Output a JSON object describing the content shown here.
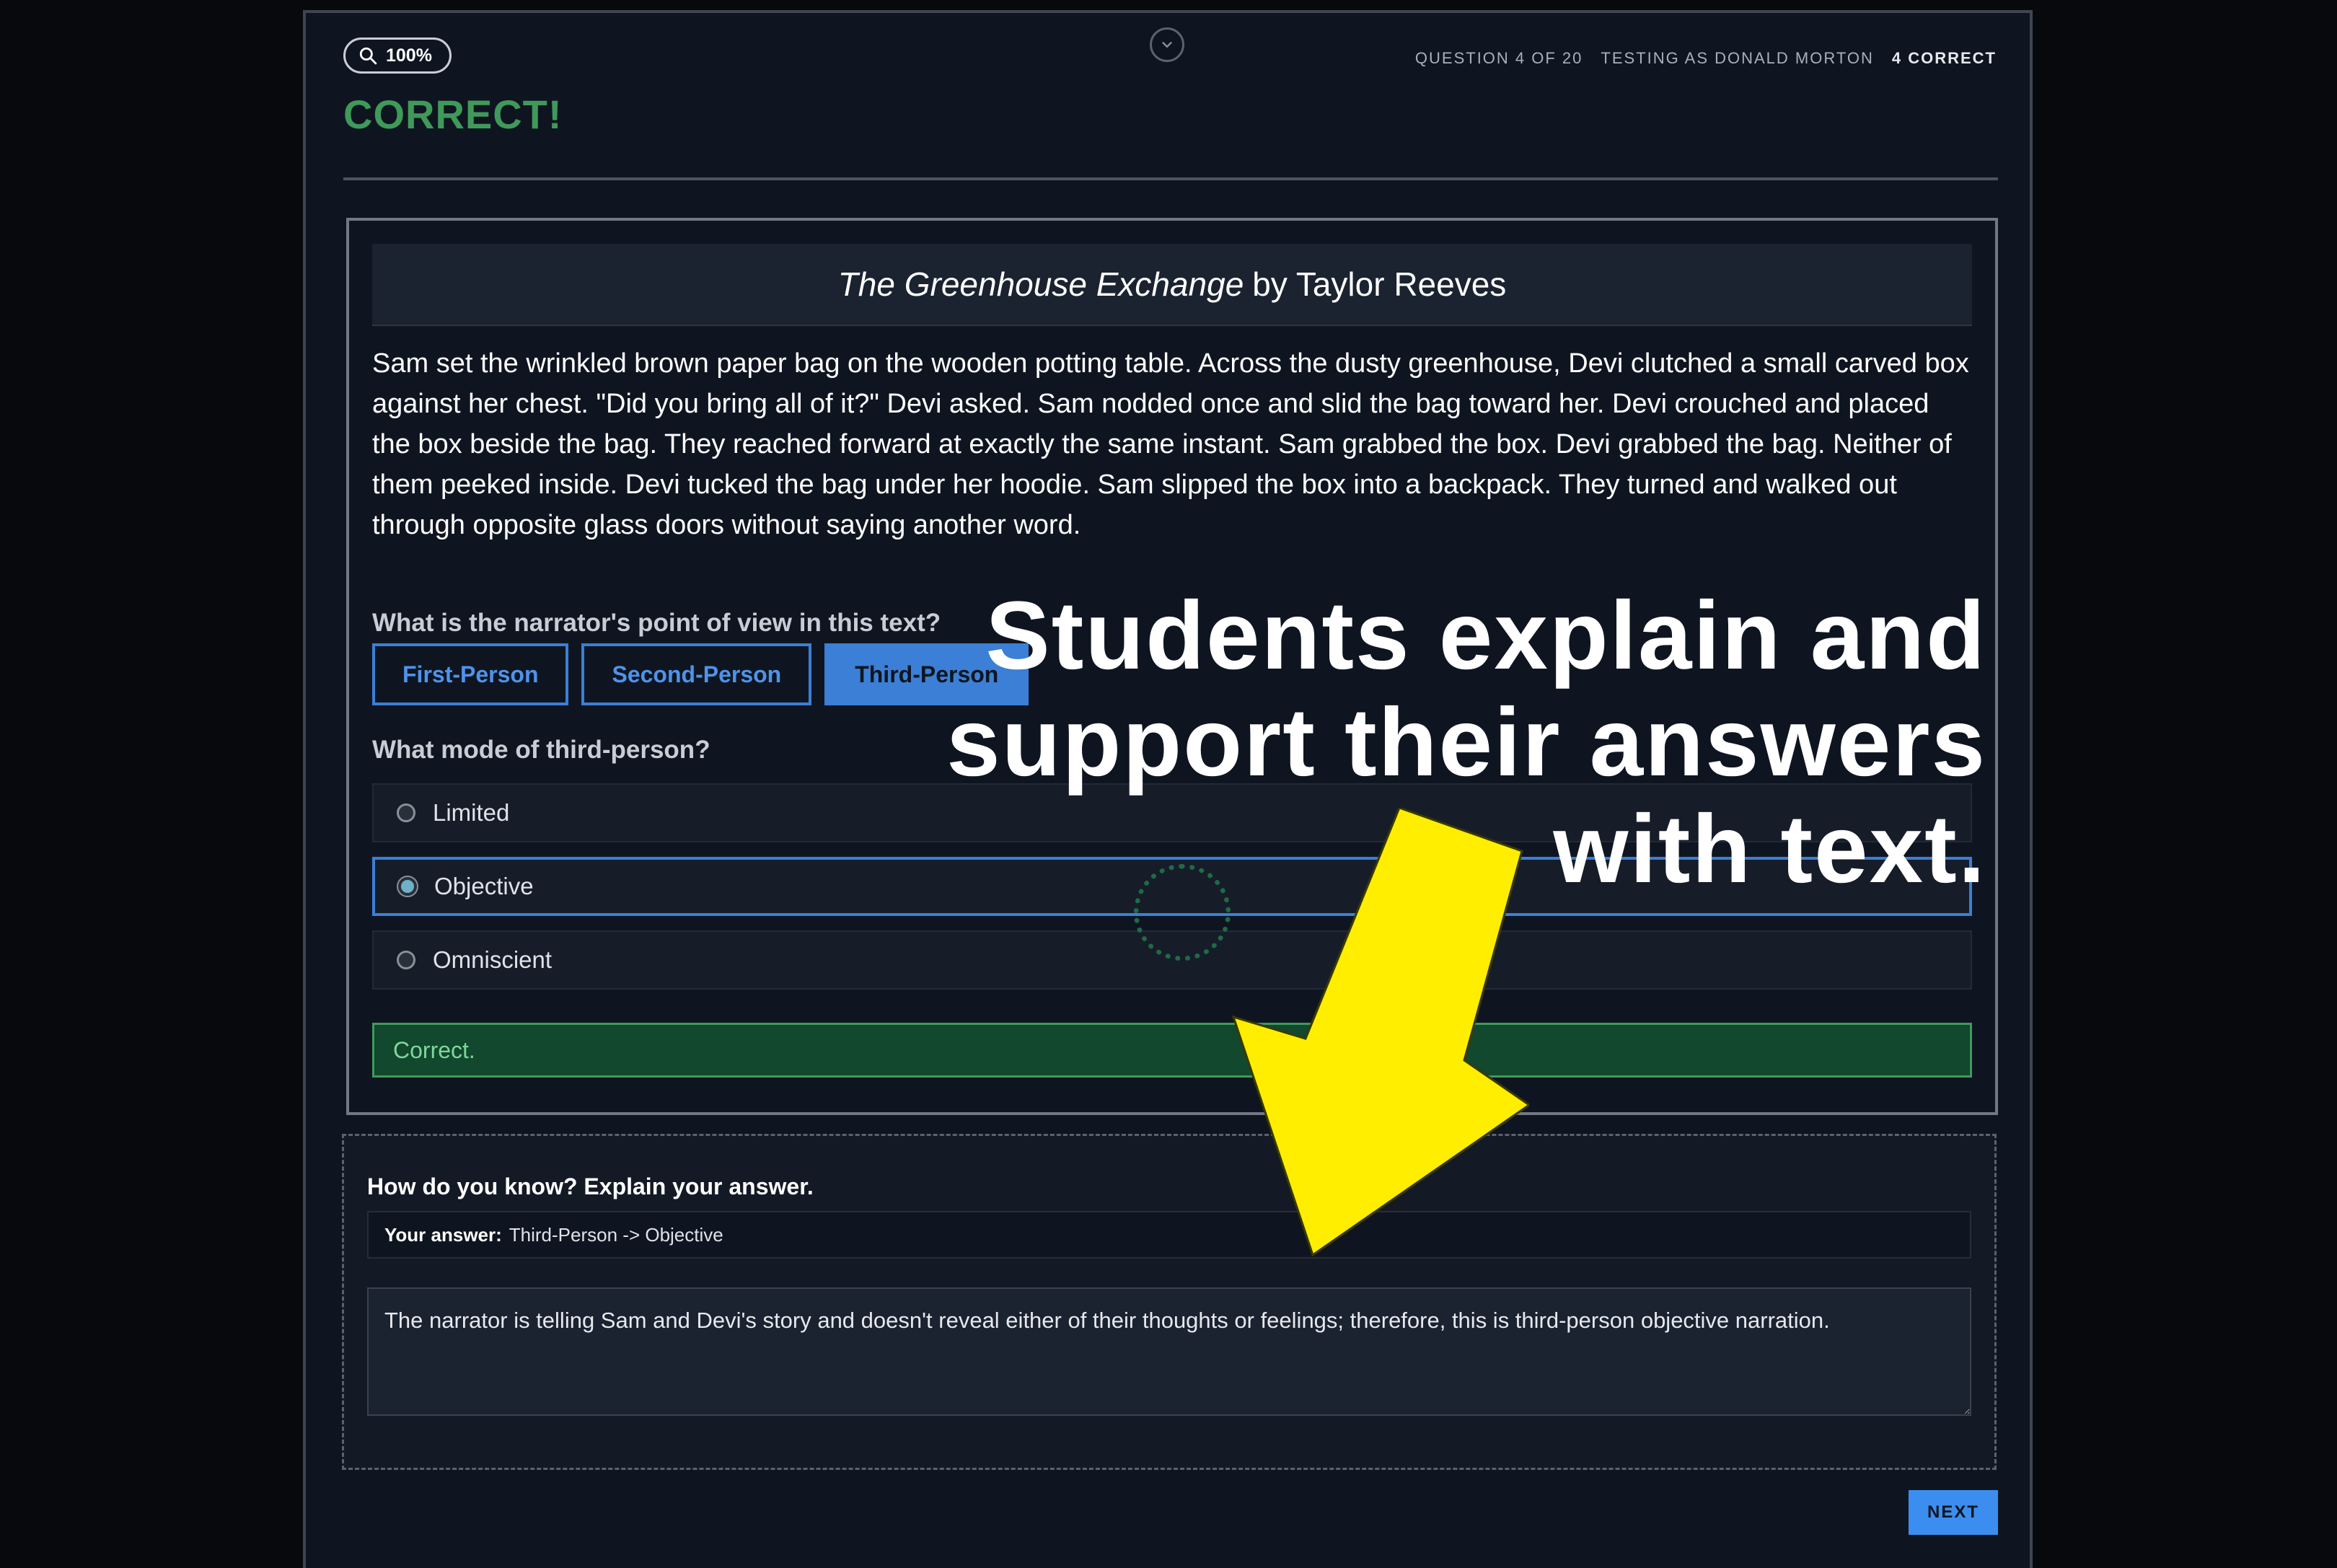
{
  "toolbar": {
    "zoom_label": "100%",
    "question_progress": "QUESTION 4 OF 20",
    "tester": "TESTING AS DONALD MORTON",
    "score": "4 CORRECT"
  },
  "status": {
    "title": "CORRECT!",
    "color": "#3f9a5a"
  },
  "passage": {
    "title": "The Greenhouse Exchange",
    "byline": "by Taylor Reeves",
    "body": "Sam set the wrinkled brown paper bag on the wooden potting table. Across the dusty greenhouse, Devi clutched a small carved box against her chest. \"Did you bring all of it?\" Devi asked. Sam nodded once and slid the bag toward her. Devi crouched and placed the box beside the bag. They reached forward at exactly the same instant. Sam grabbed the box. Devi grabbed the bag. Neither of them peeked inside. Devi tucked the bag under her hoodie. Sam slipped the box into a backpack. They turned and walked out through opposite glass doors without saying another word."
  },
  "question1": {
    "prompt": "What is the narrator's point of view in this text?",
    "options": [
      {
        "label": "First-Person",
        "selected": false
      },
      {
        "label": "Second-Person",
        "selected": false
      },
      {
        "label": "Third-Person",
        "selected": true
      }
    ]
  },
  "question2": {
    "prompt": "What mode of third-person?",
    "options": [
      {
        "label": "Limited",
        "selected": false
      },
      {
        "label": "Objective",
        "selected": true
      },
      {
        "label": "Omniscient",
        "selected": false
      }
    ]
  },
  "feedback": {
    "text": "Correct."
  },
  "explain": {
    "heading": "How do you know? Explain your answer.",
    "answer_label": "Your answer:",
    "answer_value": "Third-Person -> Objective",
    "explanation": "The narrator is telling Sam and Devi's story and doesn't reveal either of their thoughts or feelings; therefore, this is third-person objective narration."
  },
  "footer": {
    "next_label": "NEXT"
  },
  "overlay": {
    "line1": "Students explain and",
    "line2": "support their answers",
    "line3": "with text.",
    "arrow_color": "#ffee00"
  },
  "icons": {
    "zoom": "search-icon",
    "collapse": "chevron-down-icon",
    "annotation": "arrow-down-icon"
  },
  "colors": {
    "accent_blue": "#3b7fd6",
    "success_bg": "#11482e",
    "success_text": "#7fd69b"
  }
}
